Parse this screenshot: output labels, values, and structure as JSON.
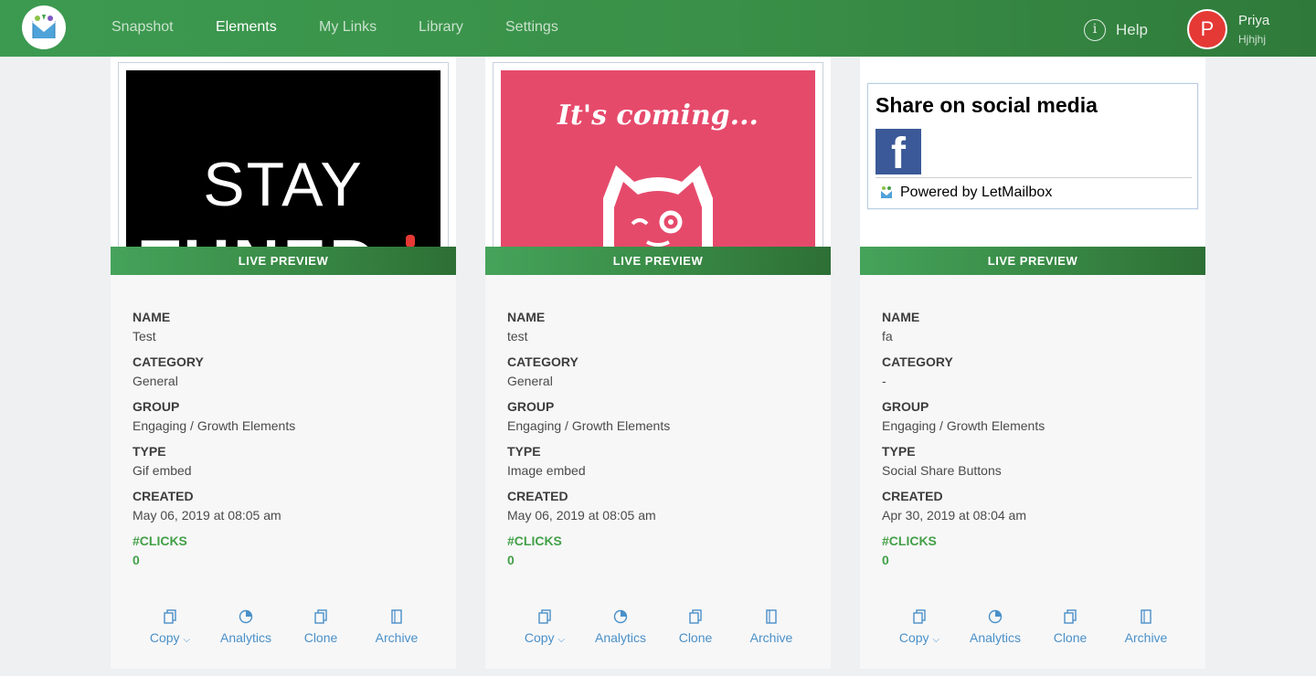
{
  "header": {
    "nav": [
      {
        "label": "Snapshot",
        "active": false
      },
      {
        "label": "Elements",
        "active": true
      },
      {
        "label": "My Links",
        "active": false
      },
      {
        "label": "Library",
        "active": false
      },
      {
        "label": "Settings",
        "active": false
      }
    ],
    "help_label": "Help",
    "user": {
      "initial": "P",
      "name": "Priya",
      "sub": "Hjhjhj",
      "avatar_color": "#e53935"
    }
  },
  "labels": {
    "live_preview": "LIVE PREVIEW",
    "name": "NAME",
    "category": "CATEGORY",
    "group": "GROUP",
    "type": "TYPE",
    "created": "CREATED",
    "clicks": "#CLICKS"
  },
  "actions": {
    "copy": "Copy",
    "analytics": "Analytics",
    "clone": "Clone",
    "archive": "Archive"
  },
  "cards": [
    {
      "preview": {
        "line1": "STAY",
        "line2": "TUNED"
      },
      "name": "Test",
      "category": "General",
      "group": "Engaging / Growth Elements",
      "type": "Gif embed",
      "created": "May 06, 2019 at 08:05 am",
      "clicks": "0"
    },
    {
      "preview": {
        "text": "It's coming..."
      },
      "name": "test",
      "category": "General",
      "group": "Engaging / Growth Elements",
      "type": "Image embed",
      "created": "May 06, 2019 at 08:05 am",
      "clicks": "0"
    },
    {
      "preview": {
        "title": "Share on social media",
        "fb_glyph": "f",
        "powered": "Powered by LetMailbox"
      },
      "name": "fa",
      "category": "-",
      "group": "Engaging / Growth Elements",
      "type": "Social Share Buttons",
      "created": "Apr 30, 2019 at 08:04 am",
      "clicks": "0"
    }
  ],
  "colors": {
    "brand_green": "#3c9a50",
    "accent_green": "#43a047",
    "link_blue": "#4a90c8",
    "facebook": "#3b5998",
    "pink": "#e64a6b"
  }
}
